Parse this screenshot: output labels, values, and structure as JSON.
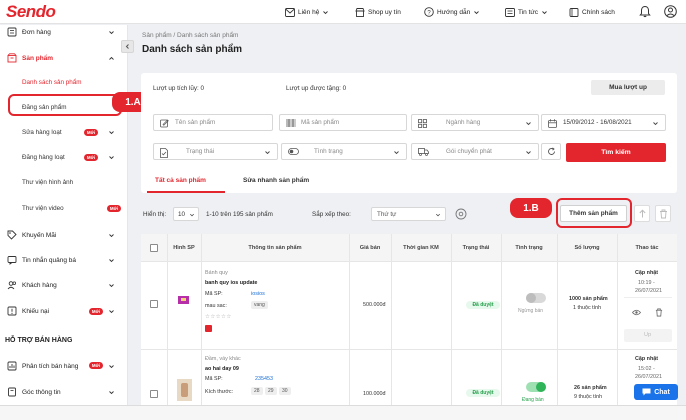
{
  "header": {
    "logo": "Sendo",
    "nav": {
      "contact": "Liên hệ",
      "trusted_shop": "Shop uy tín",
      "guide": "Hướng dẫn",
      "news": "Tin tức",
      "policy": "Chính sách"
    }
  },
  "sidebar": {
    "orders": "Đơn hàng",
    "products": "Sản phẩm",
    "sub": {
      "list": "Danh sách sản phẩm",
      "post": "Đăng sản phẩm",
      "bulk_edit": "Sửa hàng loạt",
      "bulk_post": "Đăng hàng loạt",
      "image_library": "Thư viện hình ảnh",
      "video_library": "Thư viện video"
    },
    "promotions": "Khuyến Mãi",
    "ad_messages": "Tin nhắn quảng bá",
    "customers": "Khách hàng",
    "complaints": "Khiếu nại",
    "section_support": "HỖ TRỢ BÁN HÀNG",
    "sales_analysis": "Phân tích bán hàng",
    "info_corner": "Góc thông tin",
    "new_badge": "Mới"
  },
  "annotations": {
    "a": "1.A",
    "b": "1.B"
  },
  "main": {
    "breadcrumb": "Sản phẩm  /  Danh sách sản phẩm",
    "title": "Danh sách sản phẩm",
    "accumulated_ups": "Lượt up tích lũy: 0",
    "gifted_ups": "Lượt up được tặng: 0",
    "buy_ups_button": "Mua lượt up",
    "filters": {
      "product_name": "Tên sản phẩm",
      "sku": "Mã sản phẩm",
      "category": "Ngành hàng",
      "date_range": "15/09/2012 - 16/08/2021",
      "status": "Trạng thái",
      "condition": "Tình trạng",
      "shipping_package": "Gói chuyển phát"
    },
    "search_button": "Tìm kiếm",
    "tabs": {
      "all": "Tất cả sản phẩm",
      "quick_edit": "Sửa nhanh sản phẩm"
    },
    "toolbar": {
      "show_label": "Hiển thị:",
      "page_size": "10",
      "range_text": "1-10 trên 195 sản phẩm",
      "sort_label": "Sắp xếp theo:",
      "sort_value": "Thứ tự",
      "add_product_button": "Thêm sản phẩm"
    },
    "table": {
      "headers": [
        "Hình SP",
        "Thông tin sản phẩm",
        "Giá bán",
        "Thời gian KM",
        "Trạng thái",
        "Tình trạng",
        "Số lượng",
        "Thao tác"
      ],
      "rows": [
        {
          "category": "Bánh quy",
          "name": "banh quy ios update",
          "sku_label": "Mã SP:",
          "sku": "iosios",
          "attr_label": "mau sac:",
          "attr_value": "vang",
          "stars": "☆☆☆☆☆",
          "price": "500.000đ",
          "status": "Đã duyệt",
          "condition": "Ngừng bán",
          "qty_line1": "1000 sản phẩm",
          "qty_line2": "1 thuộc tính",
          "action_title": "Cập nhật",
          "action_time": "10:19 -",
          "action_date": "26/07/2021",
          "up_label": "Up"
        },
        {
          "category": "Đầm, váy khác",
          "name": "ao hai day 09",
          "sku_label": "Mã SP:",
          "sku": "235453",
          "attr_label": "Kích thước:",
          "sizes": [
            "28",
            "29",
            "30"
          ],
          "price": "100.000đ",
          "status": "Đã duyệt",
          "condition": "Đang bán",
          "qty_line1": "26 sản phẩm",
          "qty_line2": "9 thuộc tính",
          "action_title": "Cập nhật",
          "action_time": "15:02 -",
          "action_date": "26/07/2021"
        }
      ]
    }
  },
  "chat": {
    "label": "Chat"
  },
  "colors": {
    "brand": "#e3262e",
    "success": "#25a04b",
    "chat": "#1a73e8"
  }
}
